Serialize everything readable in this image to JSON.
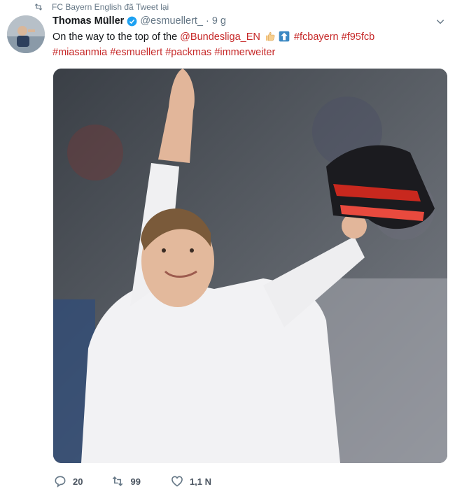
{
  "retweet_context": {
    "icon": "retweet-icon",
    "text": "FC Bayern English đã Tweet lại"
  },
  "tweet": {
    "author_name": "Thomas Müller",
    "verified_icon": "verified-badge-icon",
    "handle": "@esmuellert_",
    "separator": "·",
    "timestamp": "9 g",
    "text_line1_prefix": "On the way to the top of the ",
    "mention": "@Bundesliga_EN",
    "hashtags_line1": [
      "#fcbayern",
      "#f95fcb"
    ],
    "hashtags_line2": [
      "#miasanmia",
      "#esmuellert",
      "#packmas",
      "#immerweiter"
    ],
    "emojis": [
      "thumbs-up-emoji",
      "up-arrow-emoji"
    ]
  },
  "actions": {
    "reply": {
      "icon": "reply-icon",
      "count": "20"
    },
    "retweet": {
      "icon": "retweet-icon",
      "count": "99"
    },
    "like": {
      "icon": "heart-icon",
      "count": "1,1 N"
    }
  },
  "colors": {
    "link": "#c62828",
    "muted": "#657786",
    "verified": "#1da1f2"
  }
}
